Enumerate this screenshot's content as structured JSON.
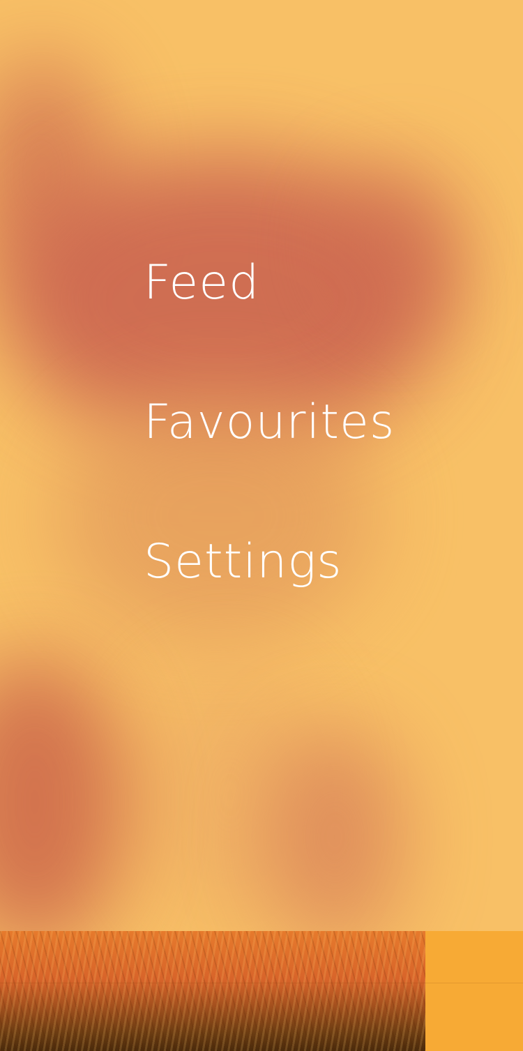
{
  "menu": {
    "items": [
      {
        "label": "Feed"
      },
      {
        "label": "Favourites"
      },
      {
        "label": "Settings"
      }
    ]
  },
  "colors": {
    "overlay": "#f8c066",
    "accent": "#f7ad3c",
    "menu_text": "#ffffff"
  },
  "background": {
    "image": "blurred-cat-photo"
  }
}
